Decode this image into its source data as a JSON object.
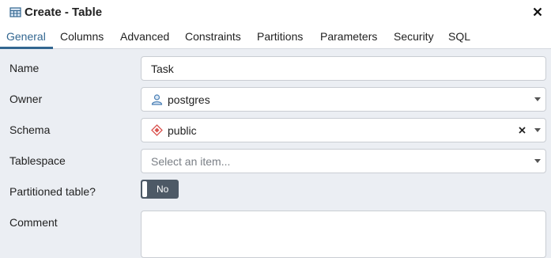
{
  "window": {
    "title": "Create - Table",
    "table_icon": "table-icon",
    "close_icon": "close-icon"
  },
  "tabs": [
    {
      "label": "General",
      "active": true
    },
    {
      "label": "Columns"
    },
    {
      "label": "Advanced"
    },
    {
      "label": "Constraints"
    },
    {
      "label": "Partitions"
    },
    {
      "label": "Parameters"
    },
    {
      "label": "Security"
    },
    {
      "label": "SQL"
    }
  ],
  "form": {
    "name": {
      "label": "Name",
      "value": "Task"
    },
    "owner": {
      "label": "Owner",
      "value": "postgres",
      "icon": "user-icon"
    },
    "schema": {
      "label": "Schema",
      "value": "public",
      "icon": "schema-icon",
      "clear_icon": "clear-icon"
    },
    "tablespace": {
      "label": "Tablespace",
      "placeholder": "Select an item..."
    },
    "partitioned": {
      "label": "Partitioned table?",
      "value": "No"
    },
    "comment": {
      "label": "Comment",
      "value": ""
    }
  },
  "colors": {
    "accent": "#326690",
    "background": "#ebeef3",
    "toggle_off": "#4d5966",
    "schema_icon": "#d9534f",
    "user_icon": "#4a7fb5"
  }
}
